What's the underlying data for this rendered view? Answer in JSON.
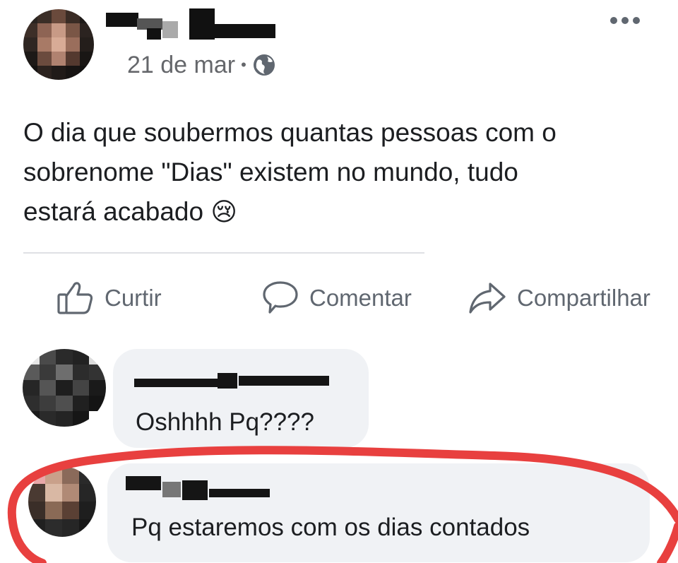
{
  "post": {
    "timestamp": "21 de mar",
    "separator": "•",
    "privacy_icon": "globe-icon",
    "text": "O dia que soubermos quantas pessoas com o\nsobrenome \"Dias\" existem no mundo, tudo\nestará acabado",
    "emoji": "😢"
  },
  "actions": {
    "like_label": "Curtir",
    "comment_label": "Comentar",
    "share_label": "Compartilhar"
  },
  "comments": [
    {
      "text": "Oshhhh Pq????"
    },
    {
      "text": "Pq estaremos com os dias contados"
    }
  ],
  "colors": {
    "text": "#1c1e21",
    "secondary_text": "#65676b",
    "bubble": "#f0f2f5",
    "highlight": "#e8403f"
  }
}
